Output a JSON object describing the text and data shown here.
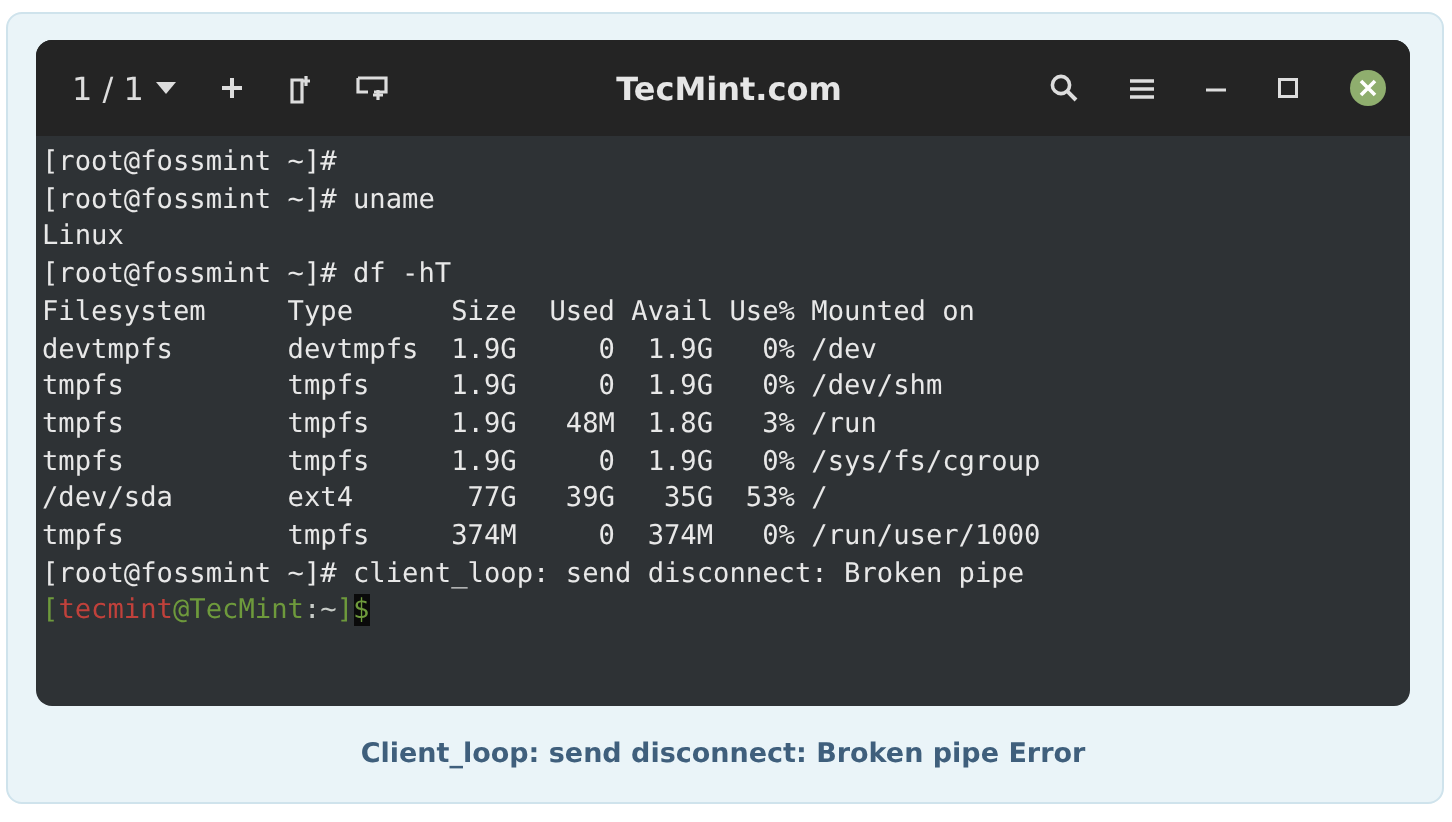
{
  "window": {
    "title": "TecMint.com",
    "tab_counter": "1 / 1"
  },
  "terminal": {
    "lines": [
      "[root@fossmint ~]#",
      "[root@fossmint ~]# uname",
      "Linux",
      "[root@fossmint ~]# df -hT",
      "Filesystem     Type      Size  Used Avail Use% Mounted on",
      "devtmpfs       devtmpfs  1.9G     0  1.9G   0% /dev",
      "tmpfs          tmpfs     1.9G     0  1.9G   0% /dev/shm",
      "tmpfs          tmpfs     1.9G   48M  1.8G   3% /run",
      "tmpfs          tmpfs     1.9G     0  1.9G   0% /sys/fs/cgroup",
      "/dev/sda       ext4       77G   39G   35G  53% /",
      "tmpfs          tmpfs     374M     0  374M   0% /run/user/1000",
      "[root@fossmint ~]# client_loop: send disconnect: Broken pipe"
    ],
    "prompt": [
      {
        "text": "[",
        "color": "#6e9a3c"
      },
      {
        "text": "tecmint",
        "color": "#c0413b"
      },
      {
        "text": "@TecMint",
        "color": "#6e9a3c"
      },
      {
        "text": ":~",
        "color": "#c8ccc8"
      },
      {
        "text": "]",
        "color": "#6e9a3c"
      }
    ],
    "cursor_text": "$"
  },
  "caption": "Client_loop: send disconnect: Broken pipe Error"
}
